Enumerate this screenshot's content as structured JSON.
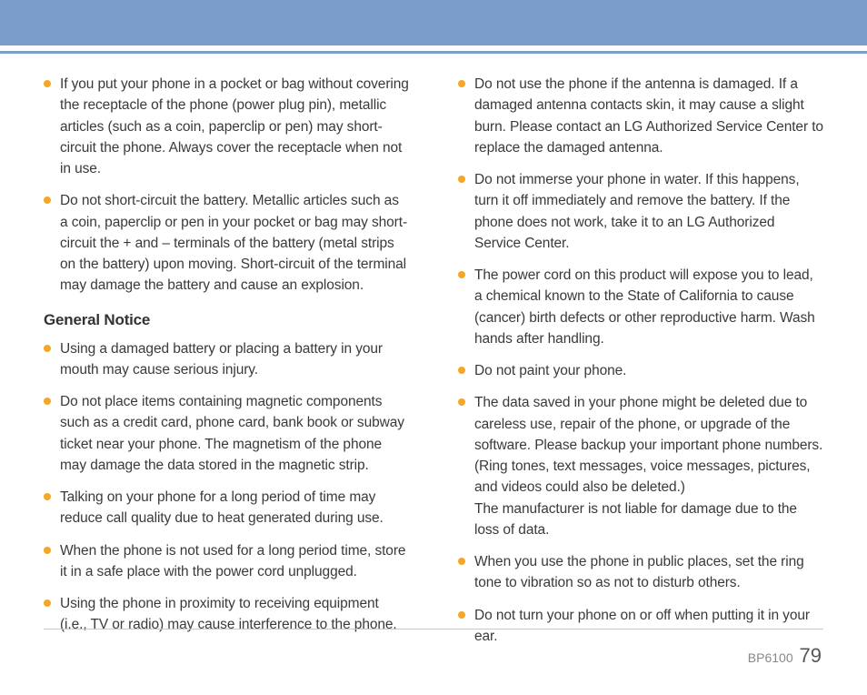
{
  "left": {
    "bullets_a": [
      "If you put your phone in a pocket or bag without covering the receptacle of the phone (power plug pin), metallic articles (such as a coin, paperclip or pen) may short-circuit the phone. Always cover the receptacle when not in use.",
      "Do not short-circuit the battery. Metallic articles such as a coin, paperclip or pen in your pocket or bag may short-circuit the + and – terminals of the battery (metal strips on the battery) upon moving. Short-circuit of the terminal may damage the battery and cause an explosion."
    ],
    "subhead": "General Notice",
    "bullets_b": [
      "Using a damaged battery or placing a battery in your mouth may cause serious injury.",
      "Do not place items containing magnetic components such as a credit card, phone card, bank book or subway ticket near your phone. The magnetism of the phone may damage the data stored in the magnetic strip.",
      "Talking on your phone for a long period of time may reduce call quality due to heat generated during use.",
      "When the phone is not used for a long period time, store it in a safe place with the power cord unplugged.",
      "Using the phone in proximity to receiving equipment (i.e., TV or radio) may cause interference to the phone."
    ]
  },
  "right": {
    "bullets": [
      "Do not use the phone if the antenna is damaged. If a damaged antenna contacts skin, it may cause a slight burn. Please contact an LG Authorized Service Center to replace the damaged antenna.",
      "Do not immerse your phone in water. If this happens, turn it off immediately and remove the battery. If the phone does not work, take it to an LG Authorized Service Center.",
      "The power cord on this product will expose you to lead, a chemical known to the State of California to cause (cancer) birth defects or other reproductive harm. Wash hands after handling.",
      "Do not paint your phone.",
      "The data saved in your phone might be deleted due to careless use, repair of the phone, or upgrade of the software. Please backup your important phone numbers. (Ring tones, text messages, voice messages, pictures, and videos could also be deleted.)\nThe manufacturer is not liable for damage due to the loss of data.",
      "When you use the phone in public places, set the ring tone to vibration so as not to disturb others.",
      "Do not turn your phone on or off when putting it in your ear."
    ]
  },
  "footer": {
    "model": "BP6100",
    "page": "79"
  }
}
